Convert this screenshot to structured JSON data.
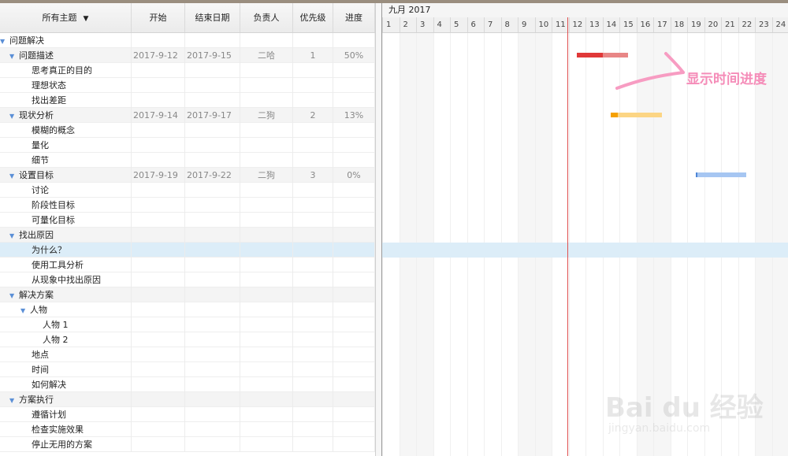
{
  "table": {
    "headers": {
      "topic": "所有主题",
      "start": "开始",
      "end": "结束日期",
      "owner": "负责人",
      "priority": "优先级",
      "progress": "进度"
    },
    "rows": [
      {
        "name": "问题解决",
        "level": 0,
        "toggle": true
      },
      {
        "name": "问题描述",
        "level": 1,
        "toggle": true,
        "start": "2017-9-12",
        "end": "2017-9-15",
        "owner": "二哈",
        "priority": "1",
        "progress": "50%"
      },
      {
        "name": "思考真正的目的",
        "level": 2
      },
      {
        "name": "理想状态",
        "level": 2
      },
      {
        "name": "找出差距",
        "level": 2
      },
      {
        "name": "现状分析",
        "level": 1,
        "toggle": true,
        "start": "2017-9-14",
        "end": "2017-9-17",
        "owner": "二狗",
        "priority": "2",
        "progress": "13%"
      },
      {
        "name": "模糊的概念",
        "level": 2
      },
      {
        "name": "量化",
        "level": 2
      },
      {
        "name": "细节",
        "level": 2
      },
      {
        "name": "设置目标",
        "level": 1,
        "toggle": true,
        "start": "2017-9-19",
        "end": "2017-9-22",
        "owner": "二狗",
        "priority": "3",
        "progress": "0%"
      },
      {
        "name": "讨论",
        "level": 2
      },
      {
        "name": "阶段性目标",
        "level": 2
      },
      {
        "name": "可量化目标",
        "level": 2
      },
      {
        "name": "找出原因",
        "level": 1,
        "toggle": true
      },
      {
        "name": "为什么？",
        "level": 2,
        "selected": true
      },
      {
        "name": "使用工具分析",
        "level": 2
      },
      {
        "name": "从现象中找出原因",
        "level": 2
      },
      {
        "name": "解决方案",
        "level": 1,
        "toggle": true
      },
      {
        "name": "人物",
        "level": 2,
        "toggle": true
      },
      {
        "name": "人物 1",
        "level": 3
      },
      {
        "name": "人物 2",
        "level": 3
      },
      {
        "name": "地点",
        "level": 2
      },
      {
        "name": "时间",
        "level": 2
      },
      {
        "name": "如何解决",
        "level": 2
      },
      {
        "name": "方案执行",
        "level": 1,
        "toggle": true
      },
      {
        "name": "遵循计划",
        "level": 2
      },
      {
        "name": "检查实施效果",
        "level": 2
      },
      {
        "name": "停止无用的方案",
        "level": 2
      }
    ]
  },
  "gantt": {
    "month_label": "九月 2017",
    "days": [
      "1",
      "2",
      "3",
      "4",
      "5",
      "6",
      "7",
      "8",
      "9",
      "10",
      "11",
      "12",
      "13",
      "14",
      "15",
      "16",
      "17",
      "18",
      "19",
      "20",
      "21",
      "22",
      "23",
      "24"
    ],
    "today_day": 11,
    "bars": [
      {
        "row": 1,
        "start": 12,
        "end": 15,
        "progress": 0.5,
        "color": "#e88686",
        "done_color": "#e03838"
      },
      {
        "row": 5,
        "start": 14,
        "end": 17,
        "progress": 0.13,
        "color": "#fcd584",
        "done_color": "#f5a000"
      },
      {
        "row": 9,
        "start": 19,
        "end": 22,
        "progress": 0.0,
        "color": "#a6c6f2",
        "done_color": "#4f86d6"
      }
    ]
  },
  "annotation": {
    "text": "显示时间进度",
    "color": "#f58cb8"
  },
  "watermark": {
    "logo": "Bai du 经验",
    "url": "jingyan.baidu.com"
  },
  "colors": {
    "selected_row": "#dcedf8",
    "today_line": "#e05050",
    "toggle": "#5b8fd6"
  }
}
